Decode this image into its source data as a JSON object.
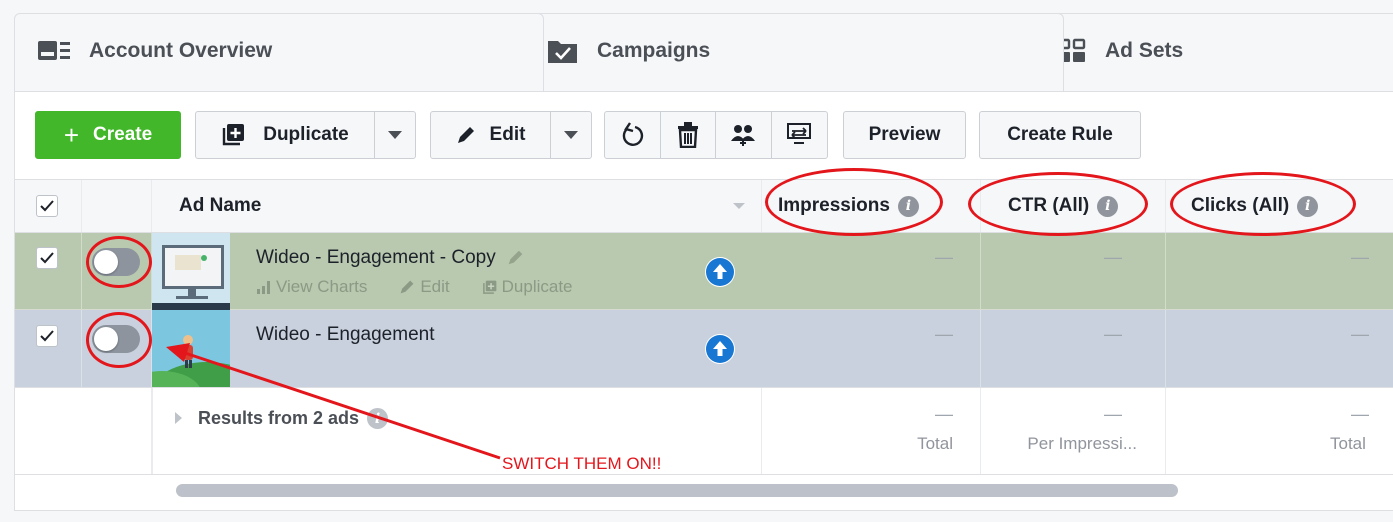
{
  "tabs": [
    {
      "label": "Account Overview",
      "icon": "account-overview-icon"
    },
    {
      "label": "Campaigns",
      "icon": "campaigns-folder-icon"
    },
    {
      "label": "Ad Sets",
      "icon": "ad-sets-grid-icon"
    }
  ],
  "toolbar": {
    "create_label": "Create",
    "duplicate_label": "Duplicate",
    "edit_label": "Edit",
    "preview_label": "Preview",
    "create_rule_label": "Create Rule"
  },
  "table": {
    "columns": {
      "ad_name": "Ad Name",
      "impressions": "Impressions",
      "ctr": "CTR (All)",
      "clicks": "Clicks (All)"
    },
    "rows": [
      {
        "name": "Wideo - Engagement - Copy",
        "checked": true,
        "active": false,
        "actions": {
          "view_charts": "View Charts",
          "edit": "Edit",
          "duplicate": "Duplicate"
        },
        "impressions": "—",
        "ctr": "—",
        "clicks": "—"
      },
      {
        "name": "Wideo - Engagement",
        "checked": true,
        "active": false,
        "impressions": "—",
        "ctr": "—",
        "clicks": "—"
      }
    ],
    "summary": {
      "label": "Results from 2 ads",
      "impressions": "—",
      "impressions_note": "Total",
      "ctr": "—",
      "ctr_note": "Per Impressi...",
      "clicks": "—",
      "clicks_note": "Total"
    }
  },
  "annotation": {
    "text": "SWITCH THEM ON!!",
    "color": "#e3161c"
  },
  "colors": {
    "create_green": "#42b72a",
    "selected_row_green": "#b9c9b0",
    "selected_row_blue": "#c8d1dd",
    "annotation_red": "#e3161c"
  }
}
